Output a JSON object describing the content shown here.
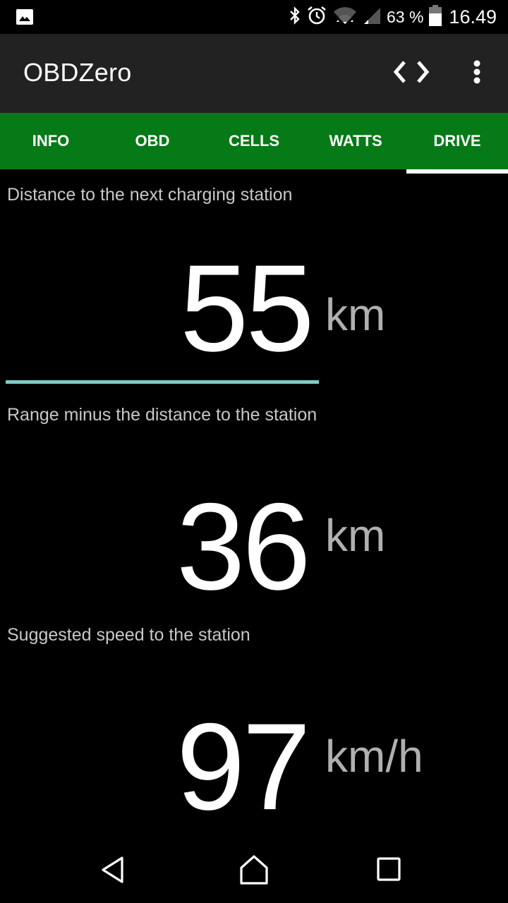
{
  "status_bar": {
    "notification_icon": "image-icon",
    "icons": [
      "bluetooth-icon",
      "alarm-icon",
      "wifi-icon",
      "signal-icon"
    ],
    "battery_percent": "63 %",
    "battery_level": 0.63,
    "time": "16.49"
  },
  "toolbar": {
    "title": "OBDZero",
    "actions": [
      "code-arrows-icon",
      "more-vert-icon"
    ]
  },
  "tabs": {
    "items": [
      {
        "label": "INFO",
        "selected": false
      },
      {
        "label": "OBD",
        "selected": false
      },
      {
        "label": "CELLS",
        "selected": false
      },
      {
        "label": "WATTS",
        "selected": false
      },
      {
        "label": "DRIVE",
        "selected": true
      }
    ],
    "accent_color": "#067a17",
    "indicator_color": "#ffffff"
  },
  "drive": {
    "distance": {
      "label": "Distance to the next charging station",
      "value": "55",
      "unit": "km",
      "progress_fraction": 0.63,
      "progress_color": "#80cbc4"
    },
    "range_minus": {
      "label": "Range minus the distance to the station",
      "value": "36",
      "unit": "km"
    },
    "speed": {
      "label": "Suggested speed to the station",
      "value": "97",
      "unit": "km/h"
    }
  },
  "nav_bar": {
    "buttons": [
      "back-icon",
      "home-icon",
      "recents-icon"
    ]
  }
}
